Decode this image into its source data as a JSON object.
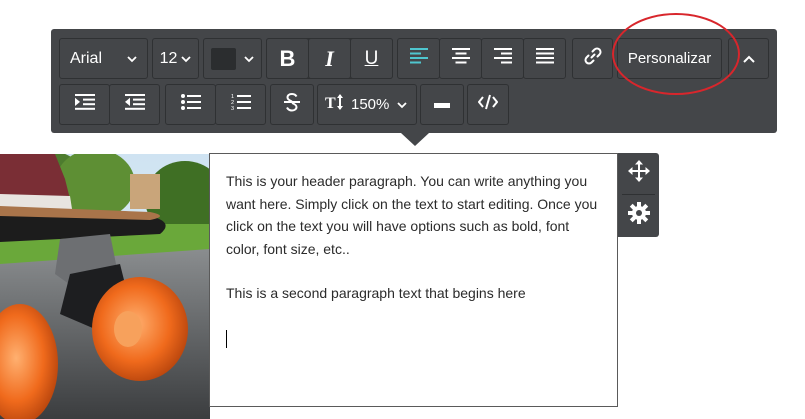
{
  "toolbar": {
    "font_family": "Arial",
    "font_size": "12",
    "text_color": "#2b2d2f",
    "bold_label": "B",
    "italic_label": "I",
    "underline_label": "U",
    "custom_label": "Personalizar",
    "line_height_value": "150%",
    "align_active": "left",
    "icons": [
      "chevron-down-icon",
      "align-left-icon",
      "align-center-icon",
      "align-right-icon",
      "align-justify-icon",
      "link-icon",
      "chevron-up-icon",
      "indent-icon",
      "outdent-icon",
      "bullet-list-icon",
      "numbered-list-icon",
      "strikethrough-icon",
      "line-height-icon",
      "horizontal-rule-icon",
      "code-icon"
    ],
    "accent_color": "#4fc6cf"
  },
  "editor": {
    "paragraph1": "This is your header paragraph. You can write anything you want here. Simply click on the text to start editing. Once you click on the text you will have options such as bold, font color, font size, etc..",
    "paragraph2": "This is a second paragraph text that begins here"
  },
  "side_tools": [
    "move-icon",
    "gear-icon"
  ],
  "annotation_color": "#d8262c"
}
